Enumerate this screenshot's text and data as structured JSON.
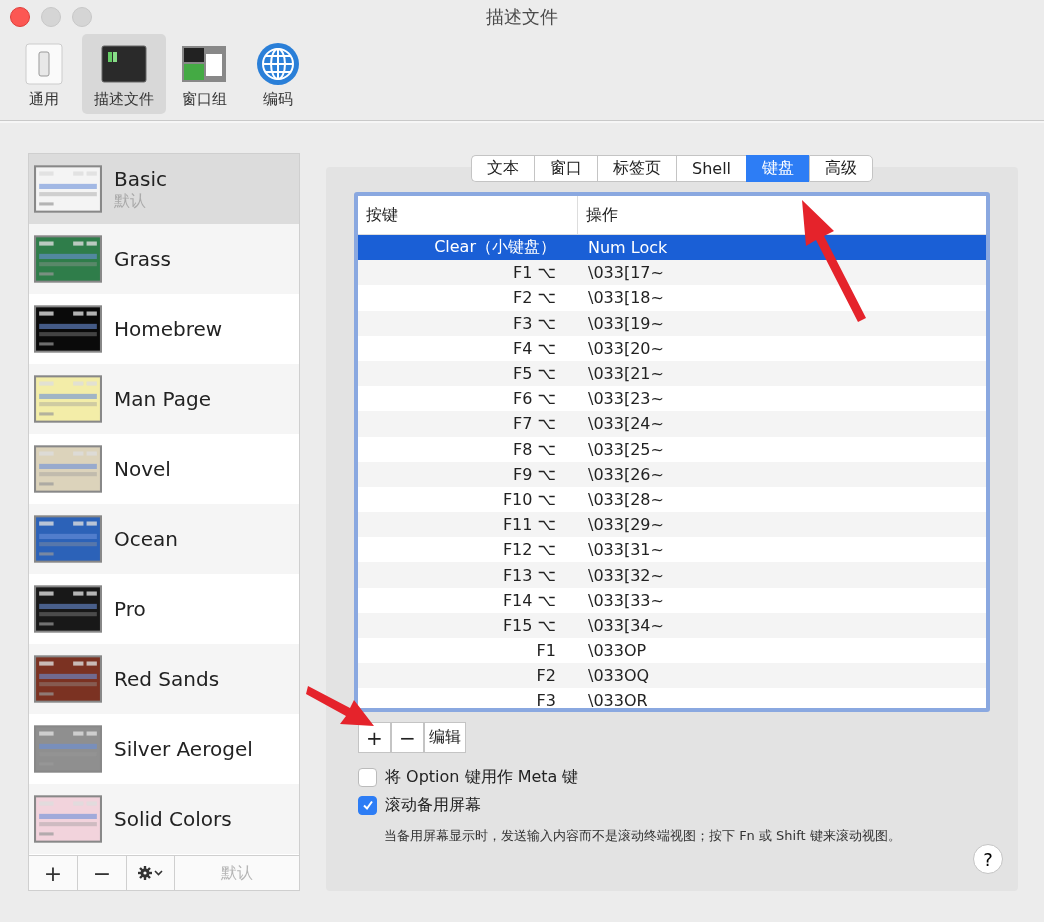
{
  "window": {
    "title": "描述文件"
  },
  "toolbar": [
    {
      "label": "通用",
      "kind": "general",
      "selected": false
    },
    {
      "label": "描述文件",
      "kind": "profiles",
      "selected": true
    },
    {
      "label": "窗口组",
      "kind": "groups",
      "selected": false
    },
    {
      "label": "编码",
      "kind": "encoding",
      "selected": false
    }
  ],
  "profiles": [
    {
      "name": "Basic",
      "subtitle": "默认",
      "selected": true,
      "color": "#f4f4f4"
    },
    {
      "name": "Grass",
      "selected": false,
      "color": "#2f7d4a"
    },
    {
      "name": "Homebrew",
      "selected": false,
      "color": "#0a0a0a"
    },
    {
      "name": "Man Page",
      "selected": false,
      "color": "#f3eda8"
    },
    {
      "name": "Novel",
      "selected": false,
      "color": "#dcd3bb"
    },
    {
      "name": "Ocean",
      "selected": false,
      "color": "#2c62b8"
    },
    {
      "name": "Pro",
      "selected": false,
      "color": "#181818"
    },
    {
      "name": "Red Sands",
      "selected": false,
      "color": "#7b3222"
    },
    {
      "name": "Silver Aerogel",
      "selected": false,
      "color": "#8f8f8f"
    },
    {
      "name": "Solid Colors",
      "selected": false,
      "color": "#f2d3dc"
    }
  ],
  "profile_buttons": {
    "add": "+",
    "remove": "−",
    "default": "默认"
  },
  "tabs": [
    {
      "label": "文本",
      "selected": false
    },
    {
      "label": "窗口",
      "selected": false
    },
    {
      "label": "标签页",
      "selected": false
    },
    {
      "label": "Shell",
      "selected": false
    },
    {
      "label": "键盘",
      "selected": true
    },
    {
      "label": "高级",
      "selected": false
    }
  ],
  "table": {
    "columns": [
      "按键",
      "操作"
    ],
    "rows": [
      {
        "key": "Clear（小键盘）",
        "action": "Num Lock",
        "selected": true
      },
      {
        "key": "F1 ⌥",
        "action": "\\033[17~",
        "selected": false
      },
      {
        "key": "F2 ⌥",
        "action": "\\033[18~",
        "selected": false
      },
      {
        "key": "F3 ⌥",
        "action": "\\033[19~",
        "selected": false
      },
      {
        "key": "F4 ⌥",
        "action": "\\033[20~",
        "selected": false
      },
      {
        "key": "F5 ⌥",
        "action": "\\033[21~",
        "selected": false
      },
      {
        "key": "F6 ⌥",
        "action": "\\033[23~",
        "selected": false
      },
      {
        "key": "F7 ⌥",
        "action": "\\033[24~",
        "selected": false
      },
      {
        "key": "F8 ⌥",
        "action": "\\033[25~",
        "selected": false
      },
      {
        "key": "F9 ⌥",
        "action": "\\033[26~",
        "selected": false
      },
      {
        "key": "F10 ⌥",
        "action": "\\033[28~",
        "selected": false
      },
      {
        "key": "F11 ⌥",
        "action": "\\033[29~",
        "selected": false
      },
      {
        "key": "F12 ⌥",
        "action": "\\033[31~",
        "selected": false
      },
      {
        "key": "F13 ⌥",
        "action": "\\033[32~",
        "selected": false
      },
      {
        "key": "F14 ⌥",
        "action": "\\033[33~",
        "selected": false
      },
      {
        "key": "F15 ⌥",
        "action": "\\033[34~",
        "selected": false
      },
      {
        "key": "F1",
        "action": "\\033OP",
        "selected": false
      },
      {
        "key": "F2",
        "action": "\\033OQ",
        "selected": false
      },
      {
        "key": "F3",
        "action": "\\033OR",
        "selected": false
      }
    ]
  },
  "table_buttons": {
    "add": "+",
    "remove": "−",
    "edit": "编辑"
  },
  "options": [
    {
      "label": "将 Option 键用作 Meta 键",
      "checked": false
    },
    {
      "label": "滚动备用屏幕",
      "checked": true
    }
  ],
  "hint": "当备用屏幕显示时，发送输入内容而不是滚动终端视图；按下 Fn 或 Shift 键来滚动视图。",
  "help": "?"
}
